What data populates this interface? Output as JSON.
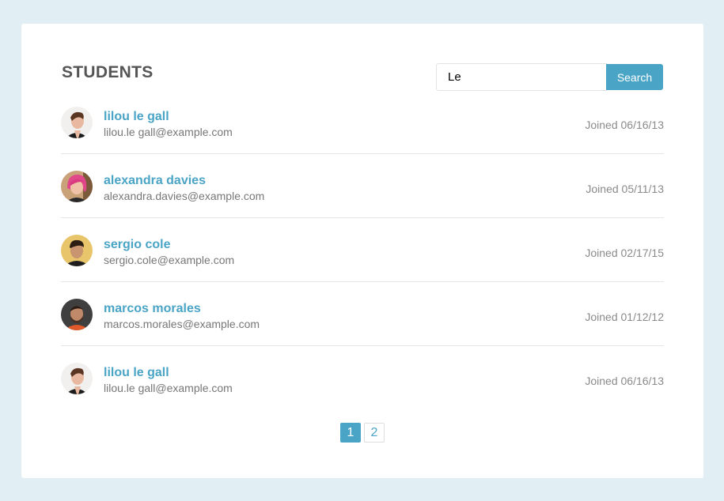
{
  "header": {
    "title": "STUDENTS"
  },
  "search": {
    "value": "Le",
    "button_label": "Search"
  },
  "students": [
    {
      "name": "lilou le gall",
      "email": "lilou.le gall@example.com",
      "joined": "Joined 06/16/13",
      "avatar": "avatar-woman-short-hair"
    },
    {
      "name": "alexandra davies",
      "email": "alexandra.davies@example.com",
      "joined": "Joined 05/11/13",
      "avatar": "avatar-woman-pink-hair"
    },
    {
      "name": "sergio cole",
      "email": "sergio.cole@example.com",
      "joined": "Joined 02/17/15",
      "avatar": "avatar-man-dark-hair"
    },
    {
      "name": "marcos morales",
      "email": "marcos.morales@example.com",
      "joined": "Joined 01/12/12",
      "avatar": "avatar-man-beard"
    },
    {
      "name": "lilou le gall",
      "email": "lilou.le gall@example.com",
      "joined": "Joined 06/16/13",
      "avatar": "avatar-woman-short-hair"
    }
  ],
  "pagination": {
    "pages": [
      "1",
      "2"
    ],
    "current": "1"
  },
  "colors": {
    "background": "#e1eff5",
    "accent": "#4aa4c5",
    "title": "#555555",
    "muted": "#8a8a8a"
  }
}
